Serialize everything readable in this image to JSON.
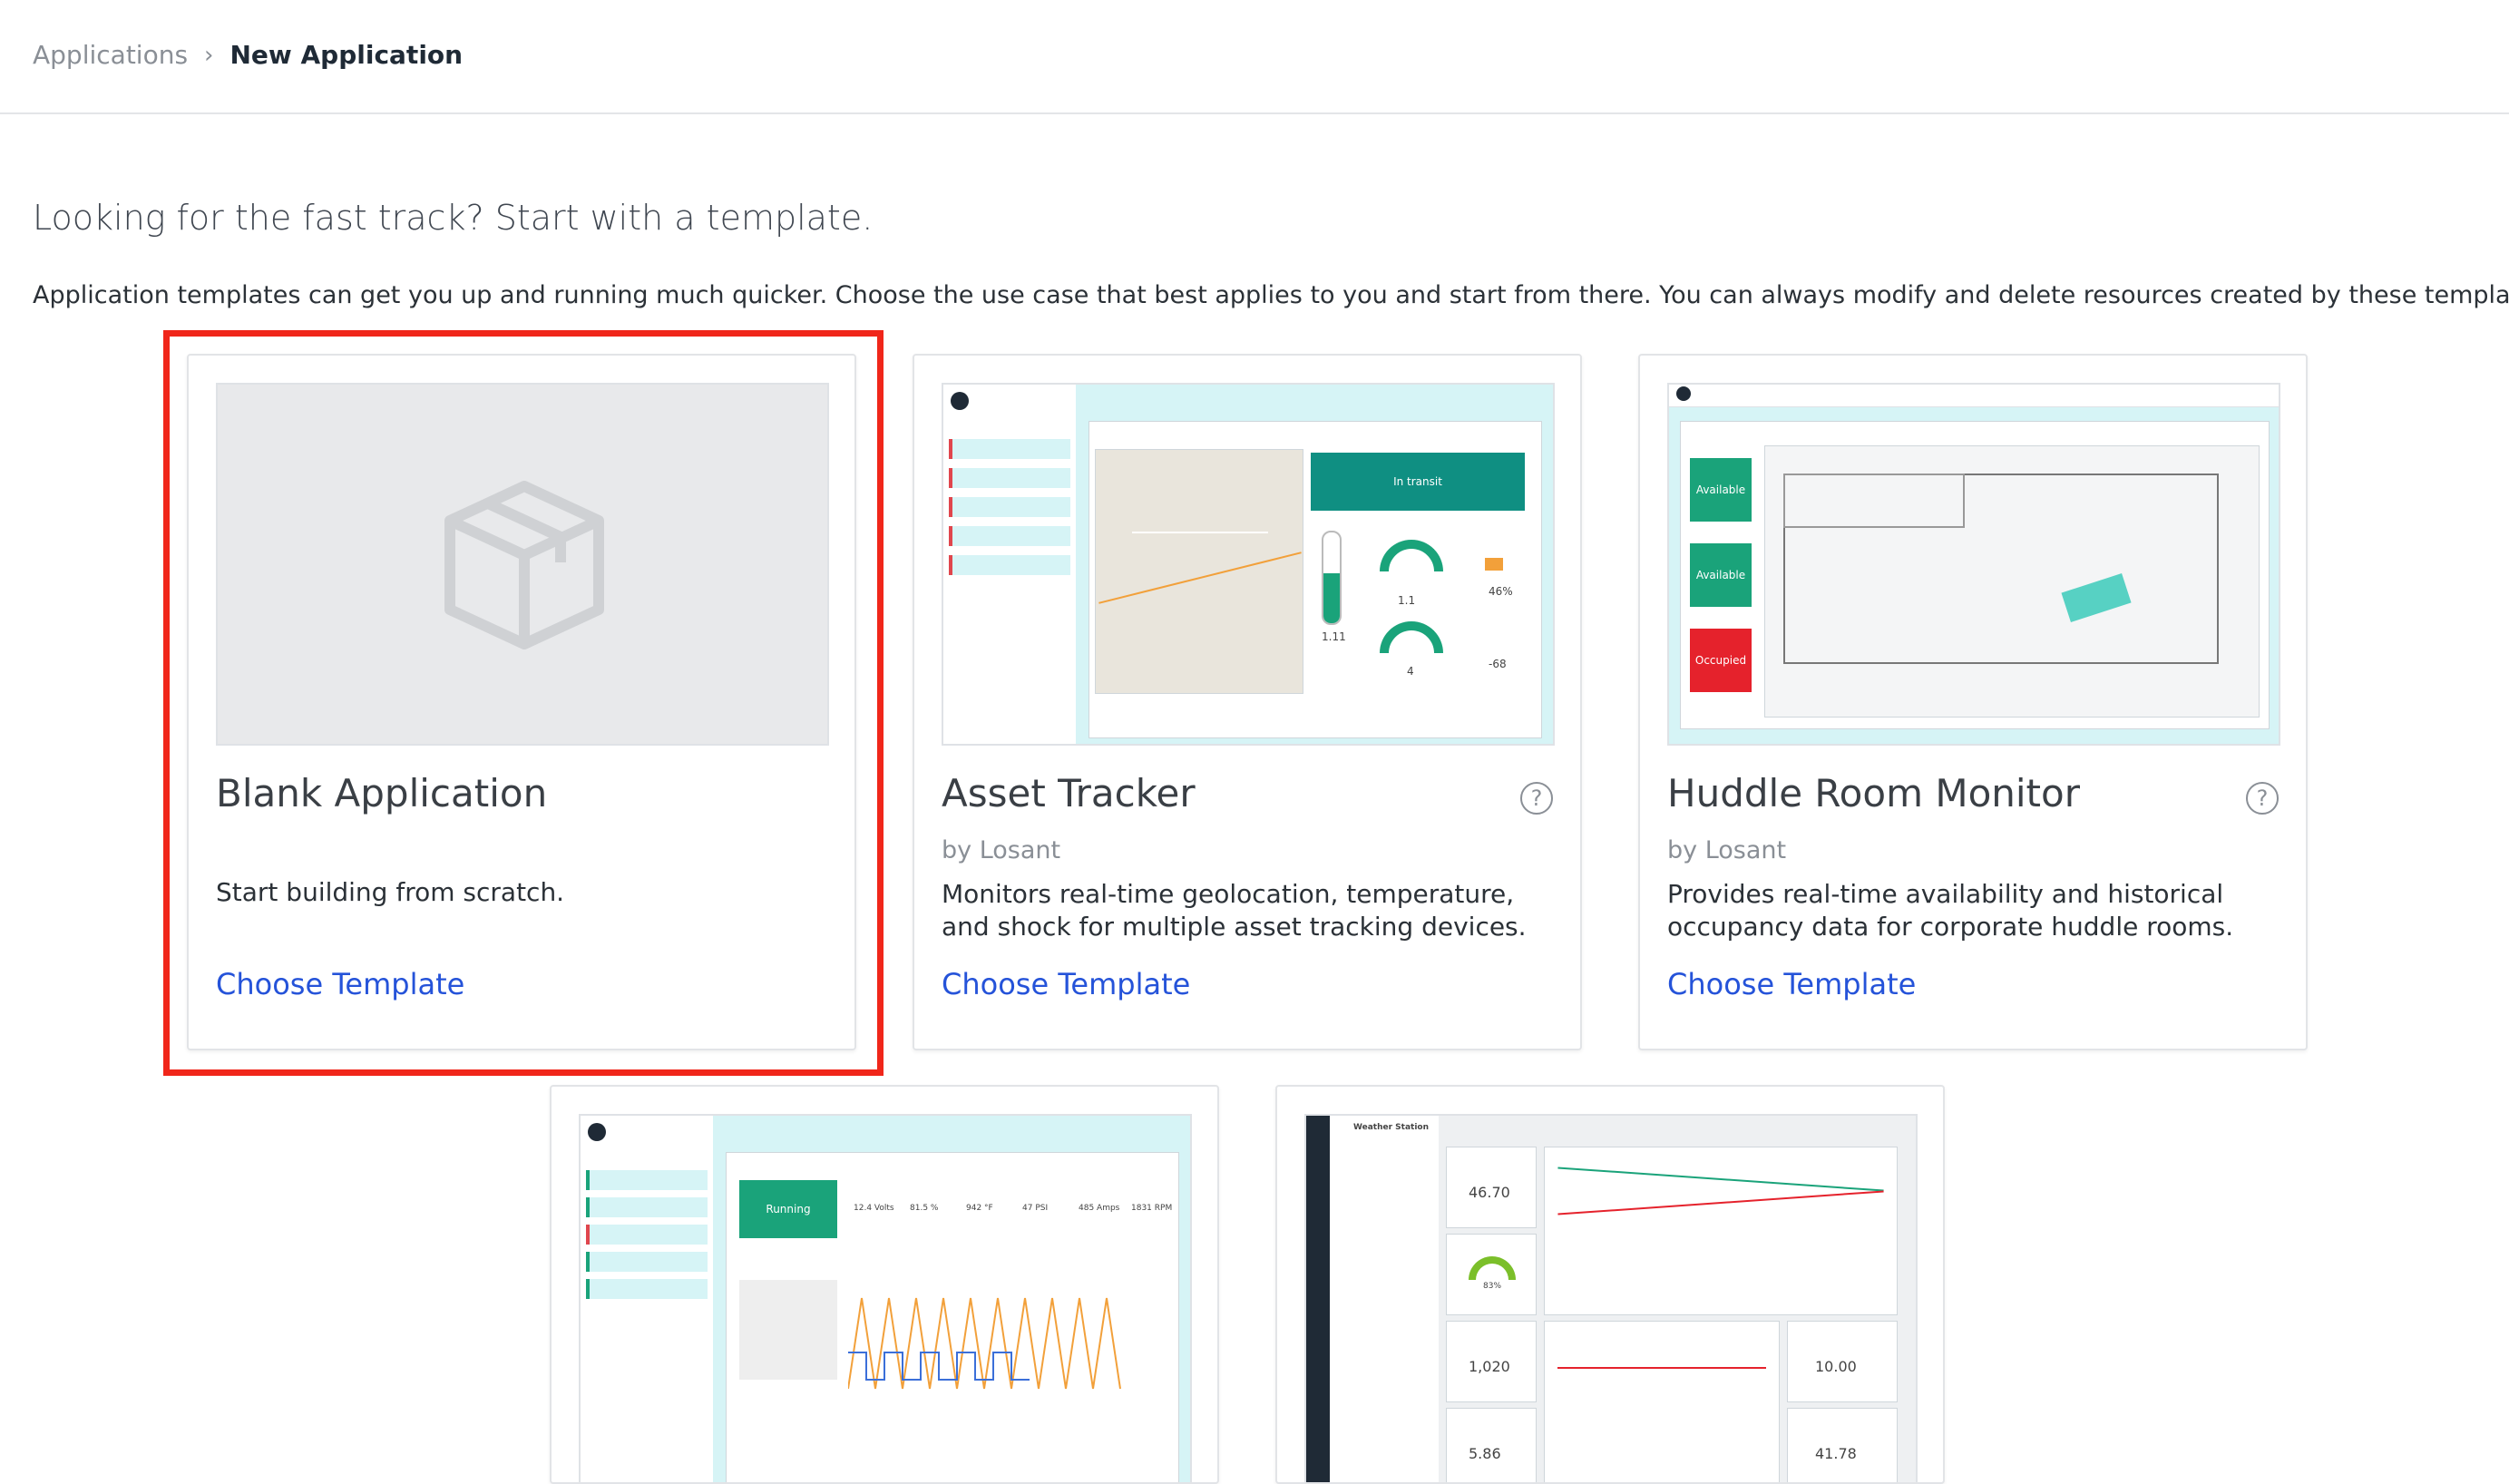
{
  "breadcrumb": {
    "parent": "Applications",
    "separator": "›",
    "current": "New Application"
  },
  "headline": "Looking for the fast track? Start with a template.",
  "description": "Application templates can get you up and running much quicker. Choose the use case that best applies to you and start from there. You can always modify and delete resources created by these templates later.",
  "templates": [
    {
      "title": "Blank Application",
      "author": "",
      "description": "Start building from scratch.",
      "action": "Choose Template",
      "selected": true
    },
    {
      "title": "Asset Tracker",
      "author": "by Losant",
      "description": "Monitors real-time geolocation, temperature, and shock for multiple asset tracking devices.",
      "action": "Choose Template",
      "help": "?"
    },
    {
      "title": "Huddle Room Monitor",
      "author": "by Losant",
      "description": "Provides real-time availability and historical occupancy data for corporate huddle rooms.",
      "action": "Choose Template",
      "help": "?"
    }
  ],
  "thumbnails": {
    "asset_tracker": {
      "status": "In transit",
      "temp": "1.11",
      "gauge": "1.1",
      "pct": "46%",
      "orient": "4",
      "shock": "-68"
    },
    "huddle_room": {
      "rooms": [
        "Available",
        "Available",
        "Occupied"
      ]
    },
    "generator": {
      "status": "Running",
      "stats": [
        "12.4 Volts",
        "81.5 %",
        "942 °F",
        "47 PSI",
        "485 Amps",
        "1831 RPM"
      ]
    },
    "weather": {
      "title": "Weather Station",
      "temperature": "46.70",
      "humidity": "83%",
      "pressure": "1,020",
      "visibility": "10.00",
      "wind_speed": "5.86",
      "dew_point": "41.78"
    }
  },
  "colors": {
    "accent_link": "#2553d9",
    "selected_outline": "#f0261a",
    "thumb_teal": "#d6f4f6",
    "status_green": "#1aa37a",
    "status_red": "#e5222c"
  }
}
